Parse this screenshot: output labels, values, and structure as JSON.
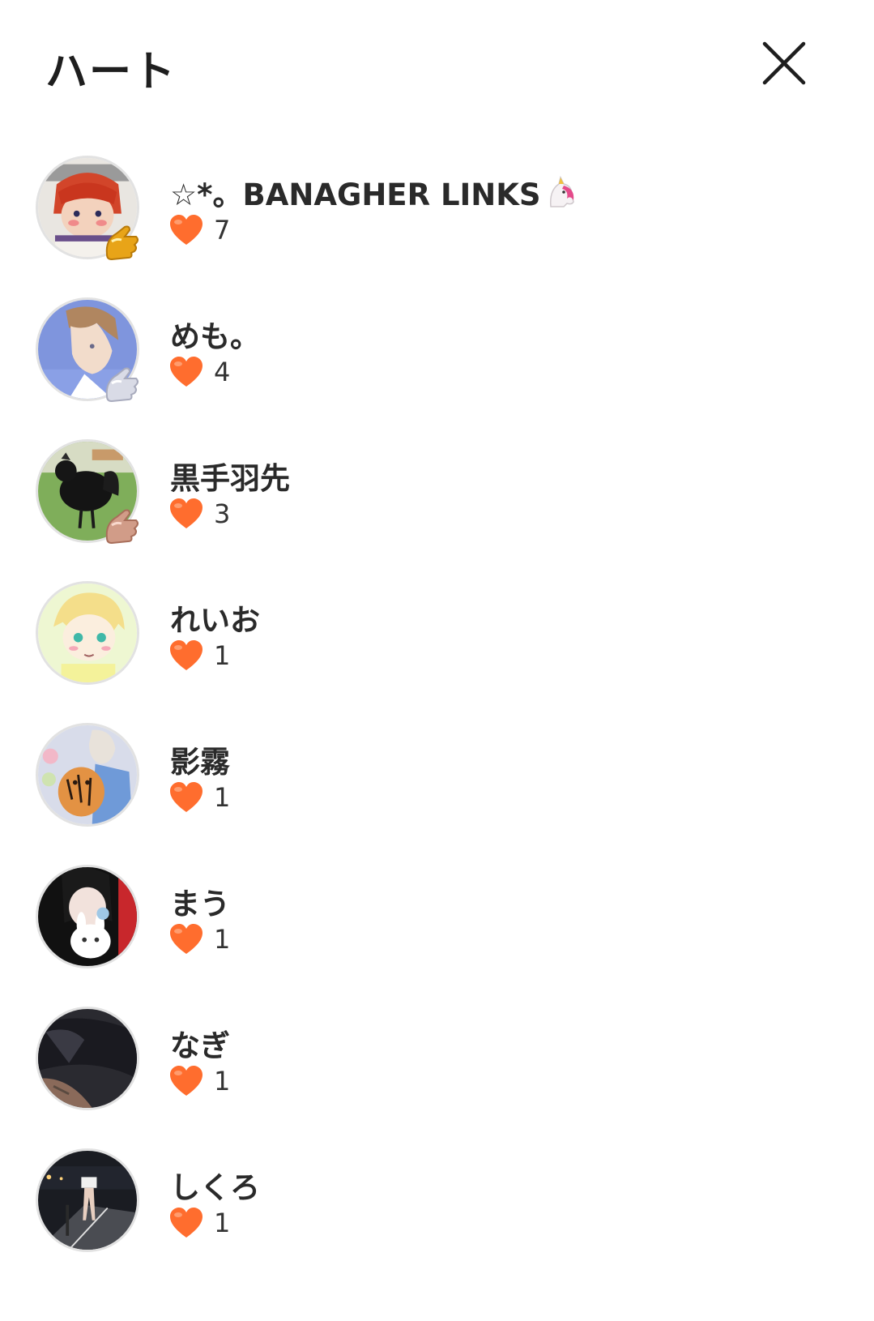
{
  "header": {
    "title": "ハート",
    "close_icon": "close-icon"
  },
  "colors": {
    "heart": "#ff6d2e",
    "text": "#222222",
    "avatar_border": "#e2e2e2"
  },
  "users": [
    {
      "name": "☆*。BANAGHER LINKS",
      "name_emoji": "unicorn-emoji",
      "hearts": "7",
      "badge": "gold-badge"
    },
    {
      "name": "めも。",
      "hearts": "4",
      "badge": "silver-badge"
    },
    {
      "name": "黒手羽先",
      "hearts": "3",
      "badge": "bronze-badge"
    },
    {
      "name": "れいお",
      "hearts": "1"
    },
    {
      "name": "影霧",
      "hearts": "1"
    },
    {
      "name": "まう",
      "hearts": "1"
    },
    {
      "name": "なぎ",
      "hearts": "1"
    },
    {
      "name": "しくろ",
      "hearts": "1"
    }
  ]
}
